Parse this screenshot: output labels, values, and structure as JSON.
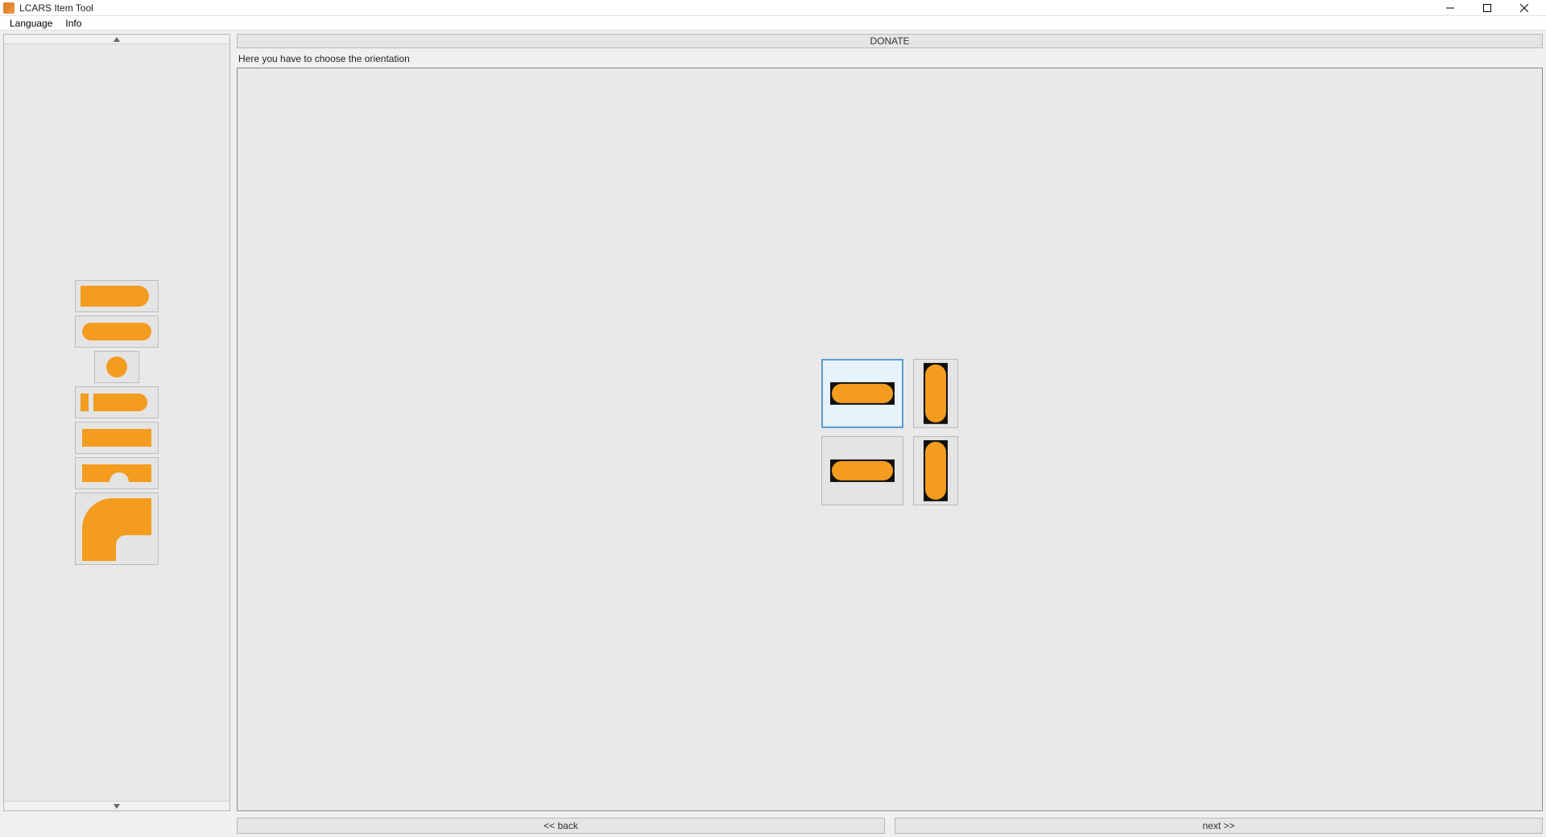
{
  "window": {
    "title": "LCARS Item Tool"
  },
  "menu": {
    "language": "Language",
    "info": "Info"
  },
  "top": {
    "donate": "DONATE"
  },
  "instruction": "Here you have to choose the orientation",
  "nav": {
    "back": "<< back",
    "next": "next >>"
  },
  "colors": {
    "orange": "#f39c1f"
  },
  "palette": {
    "items": [
      "shape-halfround-right",
      "shape-fullround-pill",
      "shape-circle",
      "shape-bar-slit-round",
      "shape-rectangle",
      "shape-notch-bottom",
      "shape-elbow-quarter"
    ]
  },
  "orientation": {
    "options": [
      "horizontal",
      "vertical",
      "horizontal-alt",
      "vertical-alt"
    ],
    "selected": 0
  }
}
